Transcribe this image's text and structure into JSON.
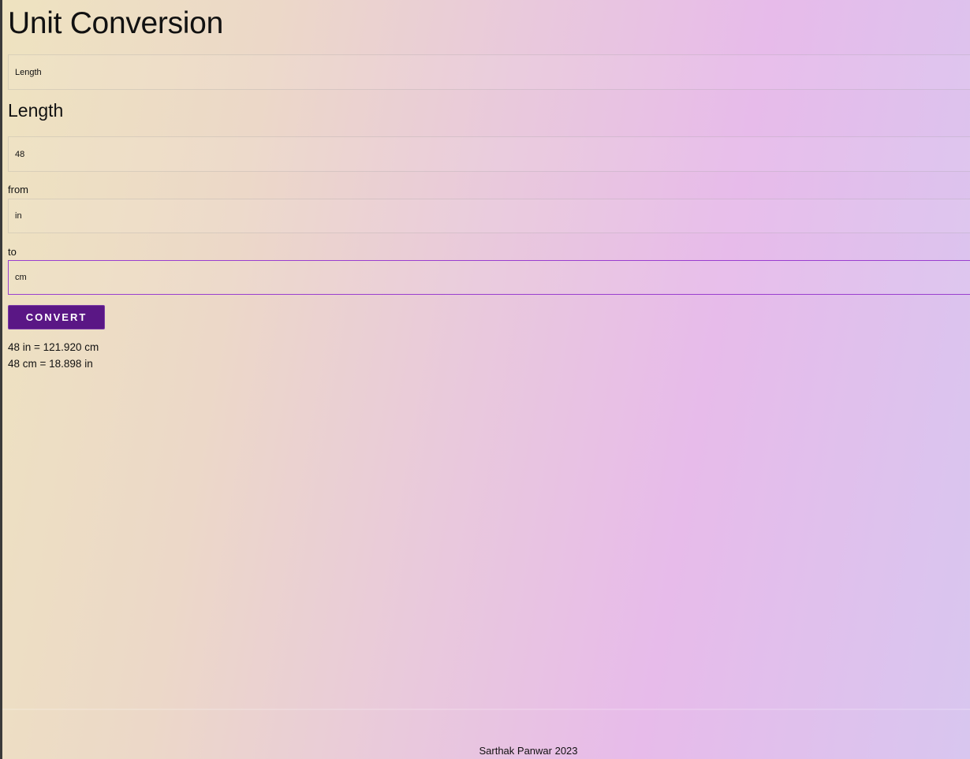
{
  "page": {
    "title": "Unit Conversion"
  },
  "category_select": {
    "value": "Length"
  },
  "section": {
    "title": "Length"
  },
  "value_input": {
    "value": "48"
  },
  "from": {
    "label": "from",
    "value": "in"
  },
  "to": {
    "label": "to",
    "value": "cm"
  },
  "convert_button": {
    "label": "CONVERT"
  },
  "results": [
    "48 in = 121.920 cm",
    "48 cm = 18.898 in"
  ],
  "footer": {
    "text": "Sarthak Panwar 2023"
  },
  "colors": {
    "accent": "#5a1785",
    "focus_border": "#9a3fcf"
  }
}
